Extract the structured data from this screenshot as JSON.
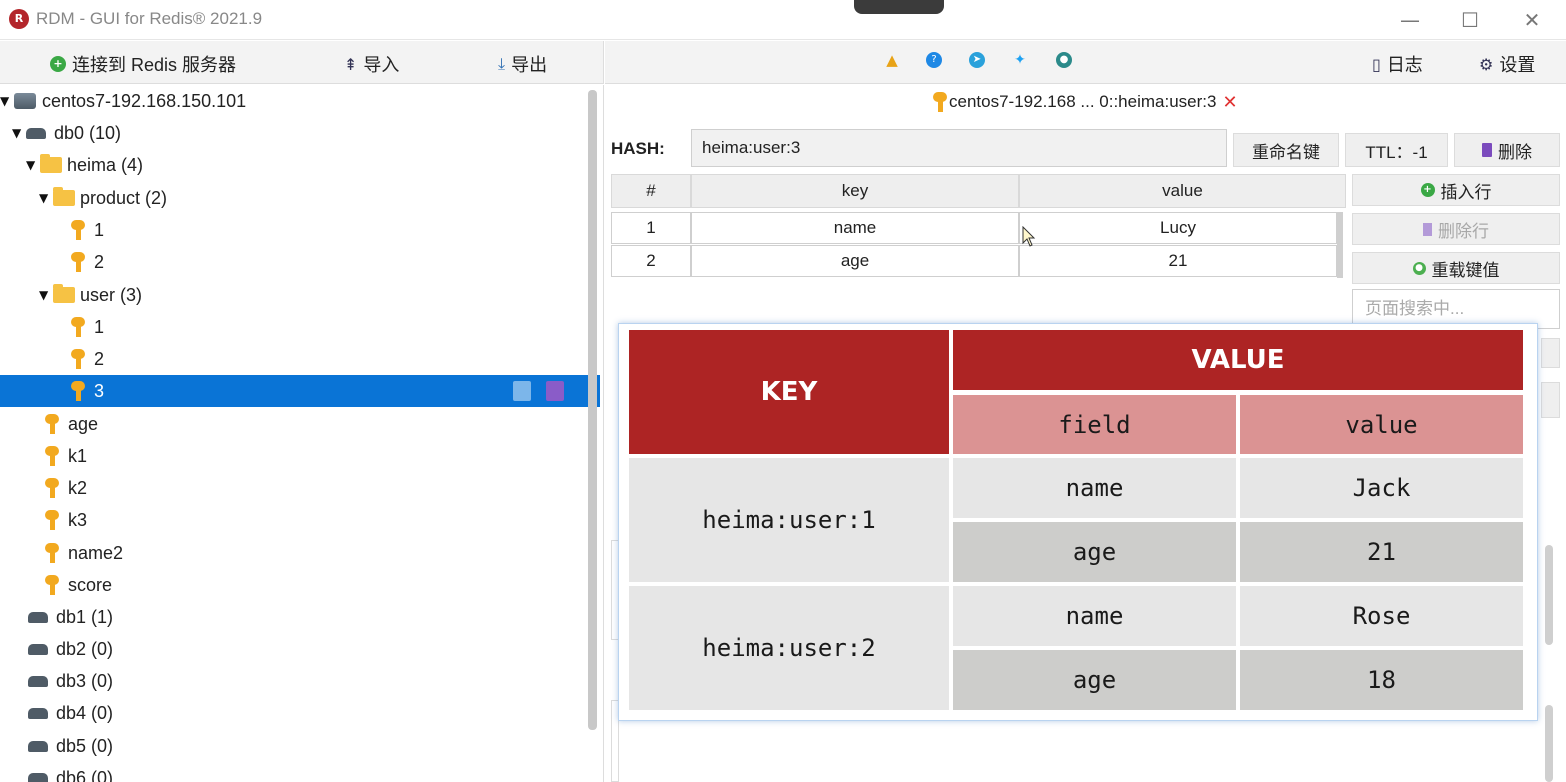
{
  "app": {
    "title": "RDM - GUI for Redis® 2021.9"
  },
  "window_controls": {
    "minimize": "—",
    "maximize": "☐",
    "close": "✕"
  },
  "left_toolbar": {
    "connect": "连接到 Redis 服务器",
    "import": "导入",
    "export": "导出"
  },
  "right_toolbar": {
    "log": "日志",
    "settings": "设置"
  },
  "tree": {
    "server": "centos7-192.168.150.101",
    "db0": "db0  (10)",
    "folder_heima": "heima (4)",
    "folder_product": "product (2)",
    "product_keys": [
      "1",
      "2"
    ],
    "folder_user": "user (3)",
    "user_keys": [
      "1",
      "2",
      "3"
    ],
    "db0_keys": [
      "age",
      "k1",
      "k2",
      "k3",
      "name2",
      "score"
    ],
    "other_dbs": [
      "db1  (1)",
      "db2  (0)",
      "db3  (0)",
      "db4  (0)",
      "db5  (0)",
      "db6  (0)"
    ]
  },
  "tab": {
    "title": "centos7-192.168 ... 0::heima:user:3",
    "close": "✕"
  },
  "key_view": {
    "type_label": "HASH:",
    "key_name": "heima:user:3",
    "rename_btn": "重命名键",
    "ttl_btn": "TTL：-1",
    "delete_btn": "删除",
    "insert_row": "插入行",
    "delete_row": "删除行",
    "reload": "重载键值",
    "search_placeholder": "页面搜索中..."
  },
  "grid": {
    "headers": [
      "#",
      "key",
      "value"
    ],
    "rows": [
      [
        "1",
        "name",
        "Lucy"
      ],
      [
        "2",
        "age",
        "21"
      ]
    ]
  },
  "overlay_table": {
    "key_header": "KEY",
    "value_header": "VALUE",
    "field_header": "field",
    "value_subheader": "value",
    "entries": [
      {
        "key": "heima:user:1",
        "rows": [
          {
            "field": "name",
            "value": "Jack"
          },
          {
            "field": "age",
            "value": "21"
          }
        ]
      },
      {
        "key": "heima:user:2",
        "rows": [
          {
            "field": "name",
            "value": "Rose"
          },
          {
            "field": "age",
            "value": "18"
          }
        ]
      }
    ]
  },
  "colors": {
    "overlay_header": "#ad2424",
    "overlay_subheader": "#db9393",
    "selection": "#0a74d6",
    "key_icon": "#f2a91f"
  }
}
